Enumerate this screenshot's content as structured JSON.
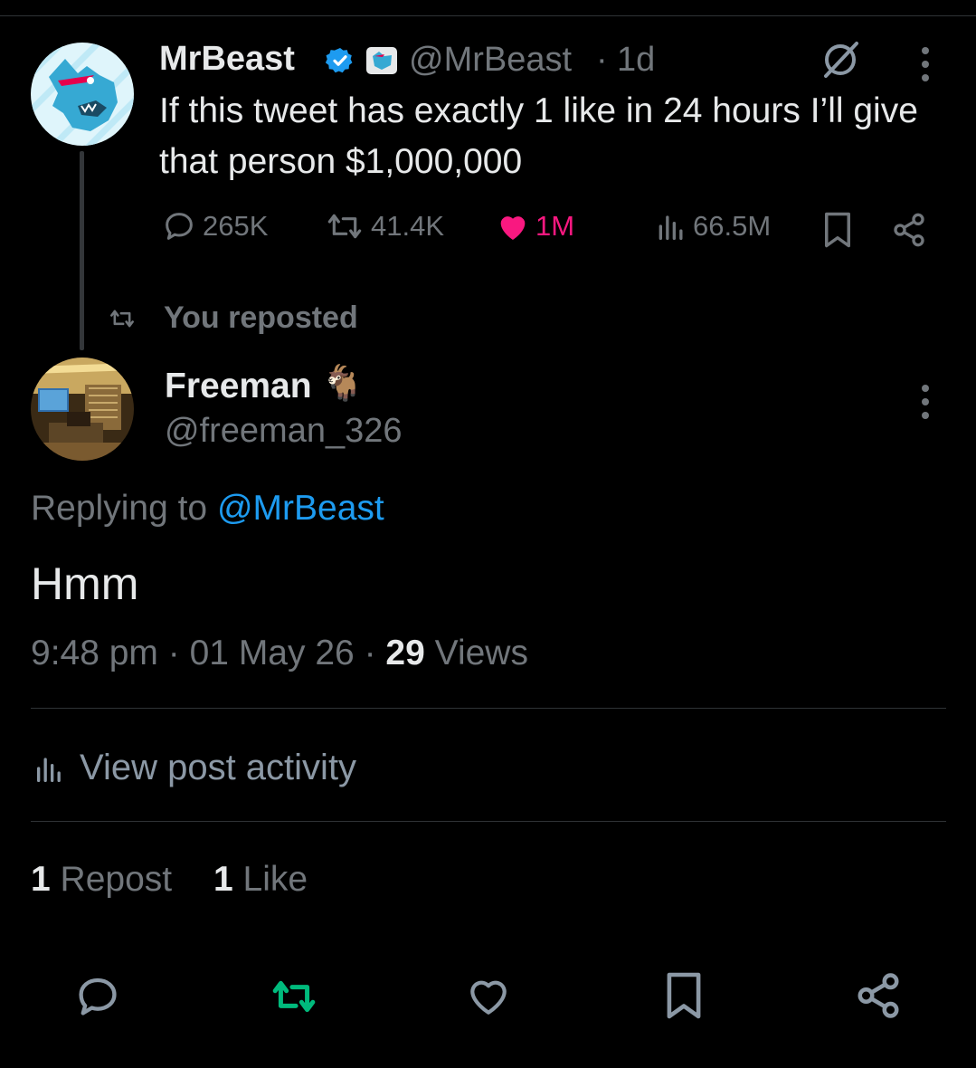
{
  "original_tweet": {
    "author_name": "MrBeast",
    "handle": "@MrBeast",
    "time_sep": "·",
    "time_ago": "1d",
    "text": "If this tweet has exactly 1 like in 24 hours I’ll give that person $1,000,000",
    "stats": {
      "replies": "265K",
      "reposts": "41.4K",
      "likes": "1M",
      "views": "66.5M"
    },
    "colors": {
      "like": "#f91880",
      "muted": "#71767b"
    }
  },
  "repost_indicator": {
    "label": "You reposted"
  },
  "reply": {
    "author_name": "Freeman",
    "emoji": "🐐",
    "handle": "@freeman_326",
    "replying_prefix": "Replying to",
    "replying_handle": "@MrBeast",
    "text": "Hmm",
    "time": "9:48 pm",
    "sep1": "·",
    "date": "01 May 26",
    "sep2": "·",
    "views_count": "29",
    "views_label": "Views"
  },
  "post_activity": {
    "label": "View post activity"
  },
  "engagement": {
    "repost_count": "1",
    "repost_label": "Repost",
    "like_count": "1",
    "like_label": "Like"
  },
  "action_bar": {
    "icons": [
      "reply-icon",
      "repost-icon",
      "like-icon",
      "bookmark-icon",
      "share-icon"
    ],
    "repost_color": "#00ba7c",
    "icon_color": "#8b98a5"
  }
}
